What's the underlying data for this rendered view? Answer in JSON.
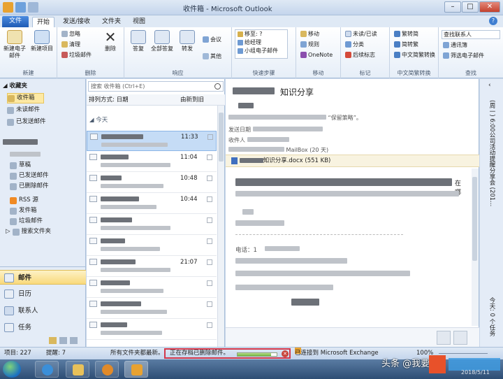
{
  "window": {
    "title": "收件箱 - Microsoft Outlook"
  },
  "tabs": [
    "文件",
    "开始",
    "发送/接收",
    "文件夹",
    "视图"
  ],
  "ribbon": {
    "groups": [
      "新建",
      "删除",
      "响应",
      "快速步骤",
      "移动",
      "标记",
      "中文简繁转换",
      "查找"
    ],
    "new_email": "新建电子邮件",
    "new_items": "新建项目",
    "ignore": "忽略",
    "cleanup": "清理",
    "junk": "垃圾邮件",
    "delete": "删除",
    "reply": "答复",
    "reply_all": "全部答复",
    "forward": "转发",
    "meeting": "会议",
    "more": "其他",
    "quick_steps": [
      "移至: ?",
      "给经理",
      "小组电子邮件"
    ],
    "move": "移动",
    "rules": "规则",
    "onenote": "OneNote",
    "unread_read": "未读/已读",
    "categorize": "分类",
    "follow_up": "后续标志",
    "trad": "繁转简",
    "simp": "简转繁",
    "conv": "中文简繁转换",
    "find_contact": "查找联系人",
    "address_book": "通讯簿",
    "filter_email": "筛选电子邮件"
  },
  "nav": {
    "favorites": "收藏夹",
    "inbox": "收件箱",
    "unread": "未读邮件",
    "sent_fav": "已发送邮件",
    "drafts": "草稿",
    "sent": "已发送邮件",
    "deleted": "已删除邮件",
    "rss": "RSS 源",
    "outbox": "发件箱",
    "junk": "垃圾邮件",
    "search_folders": "搜索文件夹",
    "mail": "邮件",
    "calendar": "日历",
    "contacts": "联系人",
    "tasks": "任务"
  },
  "list": {
    "search_placeholder": "搜索 收件箱 (Ctrl+E)",
    "sort_label": "排列方式: 日期",
    "order_label": "由新到旧",
    "group_header": "今天",
    "times": [
      "11:33",
      "11:04",
      "10:48",
      "10:44",
      "",
      "",
      "21:07",
      "",
      "",
      "",
      ""
    ]
  },
  "reading": {
    "subject": "知识分享",
    "policy": "保留策略",
    "from_label": "发送日期",
    "to_label": "收件人",
    "retention": "MailBox (20 天)",
    "attachment": "知识分享.docx (551 KB)",
    "phone_label": "电话：1",
    "body_frag": "在哪"
  },
  "todo": {
    "label_top": "(周一) 6:00公司活动提醒分享会 (201...",
    "label_bottom": "今天: 0 个任务"
  },
  "status": {
    "items": "项目: 227",
    "reminders": "提醒: 7",
    "folder_state": "所有文件夹都最新。",
    "archiving": "正在存档已删除邮件。",
    "progress": 0.85,
    "connected": "已连接到 Microsoft Exchange",
    "zoom": "100%"
  },
  "watermark": "头条 @我要",
  "date": "2018/5/11",
  "colors": {
    "accent": "#1f5bb5",
    "selection": "#c5dcf6",
    "highlight_box": "#d3374a"
  }
}
